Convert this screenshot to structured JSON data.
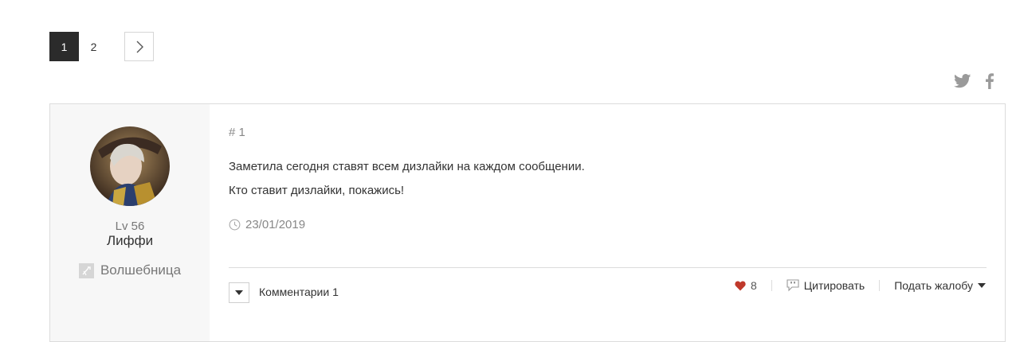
{
  "pagination": {
    "pages": [
      "1",
      "2"
    ],
    "active_page": "1",
    "next_icon": "chevron-right-icon"
  },
  "social": {
    "twitter_icon": "twitter-icon",
    "facebook_icon": "facebook-icon"
  },
  "author": {
    "level": "Lv 56",
    "name": "Лиффи",
    "class_name": "Волшебница",
    "class_icon": "class-icon"
  },
  "post": {
    "number": "# 1",
    "lines": [
      "Заметила сегодня ставят всем дизлайки на каждом сообщении.",
      "Кто ставит дизлайки, покажись!"
    ],
    "date": "23/01/2019",
    "comments_label": "Комментарии 1",
    "likes": "8",
    "quote_label": "Цитировать",
    "report_label": "Подать жалобу"
  },
  "colors": {
    "active_page_bg": "#2b2b2b",
    "heart": "#c0392b",
    "author_bg": "#f7f7f7"
  }
}
